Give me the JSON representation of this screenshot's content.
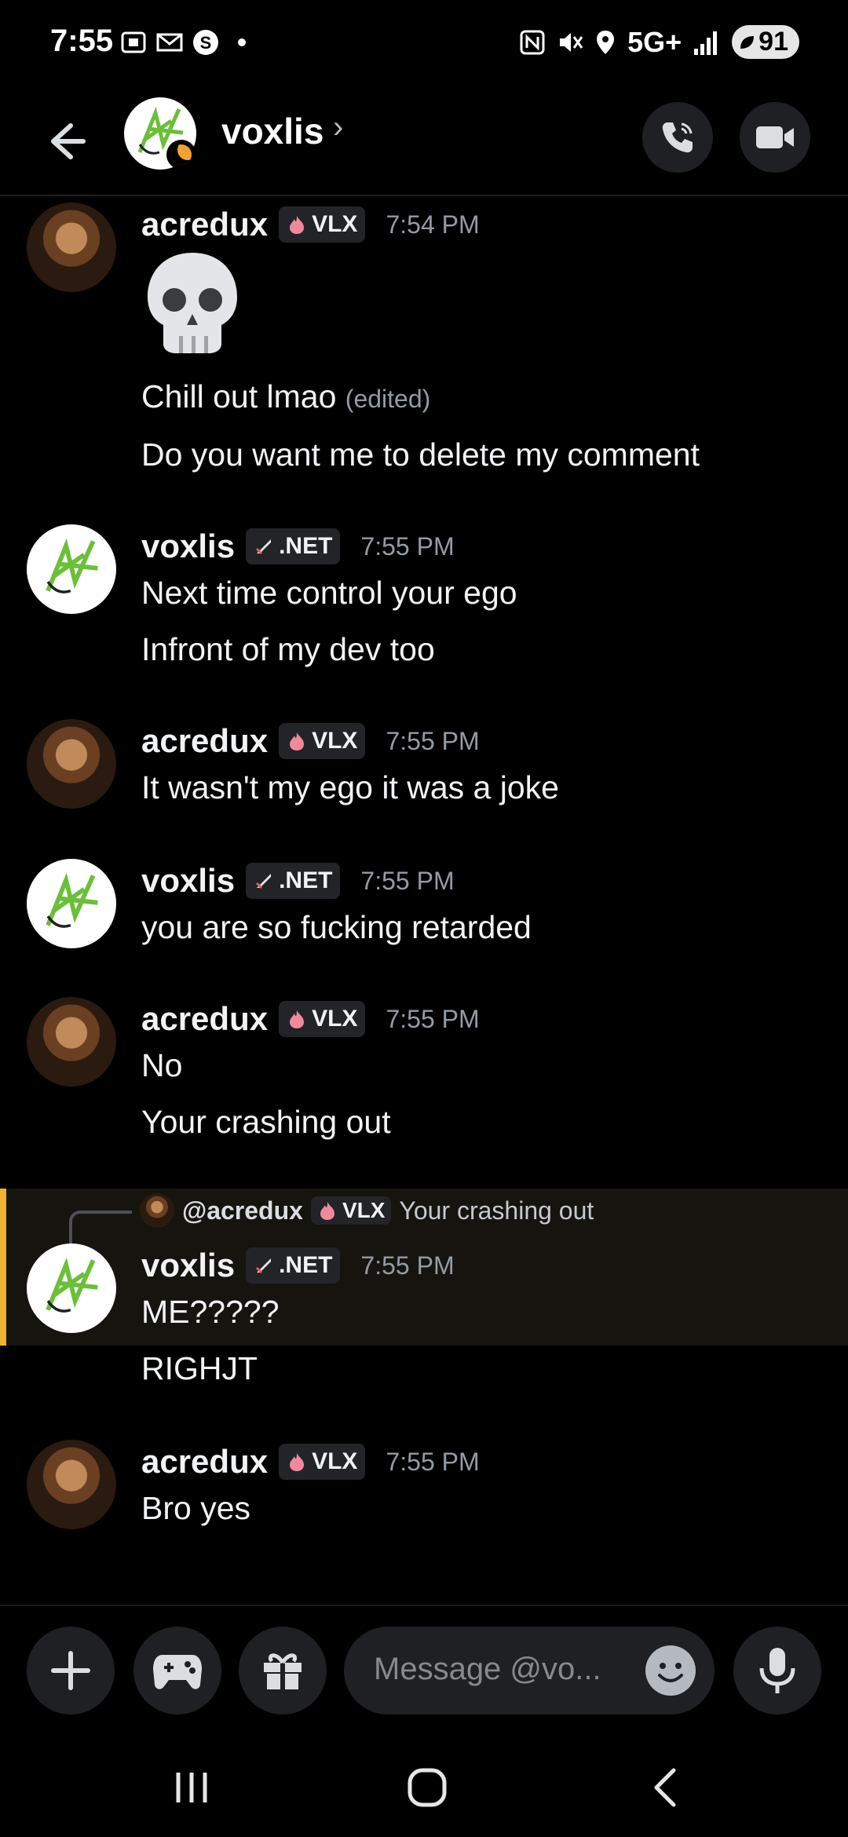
{
  "status_bar": {
    "time": "7:55",
    "network": "5G+",
    "battery": "91"
  },
  "header": {
    "contact_name": "voxlis",
    "chevron": "›"
  },
  "messages": [
    {
      "user": "acredux",
      "tag": "VLX",
      "time": "7:54 PM",
      "lines": [
        "Chill out lmao",
        "Do you want me to delete my comment"
      ],
      "edited_label": "(edited)"
    },
    {
      "user": "voxlis",
      "tag": ".NET",
      "time": "7:55 PM",
      "lines": [
        "Next time control your ego",
        "Infront of my dev too"
      ]
    },
    {
      "user": "acredux",
      "tag": "VLX",
      "time": "7:55 PM",
      "lines": [
        "It wasn't my ego it was a joke"
      ]
    },
    {
      "user": "voxlis",
      "tag": ".NET",
      "time": "7:55 PM",
      "lines": [
        "you are so fucking retarded"
      ]
    },
    {
      "user": "acredux",
      "tag": "VLX",
      "time": "7:55 PM",
      "lines": [
        "No",
        "Your crashing out"
      ]
    },
    {
      "user": "voxlis",
      "tag": ".NET",
      "time": "7:55 PM",
      "lines": [
        "ME?????",
        "RIGHJT"
      ],
      "reply": {
        "user": "@acredux",
        "tag": "VLX",
        "text": "Your crashing out"
      }
    },
    {
      "user": "acredux",
      "tag": "VLX",
      "time": "7:55 PM",
      "lines": [
        "Bro yes"
      ]
    }
  ],
  "composer": {
    "placeholder": "Message @vo..."
  },
  "colors": {
    "background": "#000000",
    "highlight_border": "#f0b232",
    "muted": "#949ba4"
  },
  "icons": {
    "vlx_tag": "flame-icon",
    "net_tag": "sword-icon"
  }
}
